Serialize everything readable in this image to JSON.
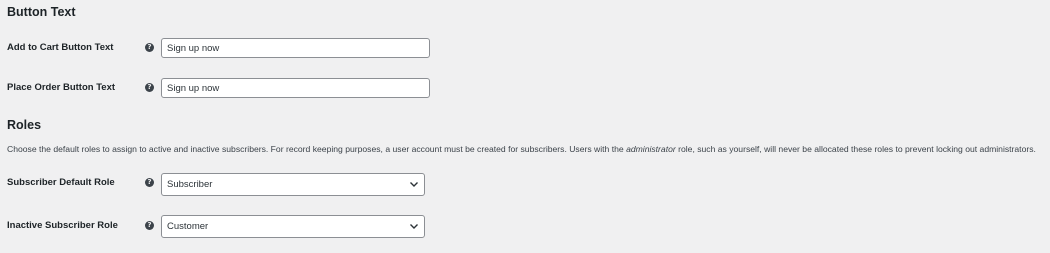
{
  "button_text_section": {
    "title": "Button Text",
    "add_to_cart": {
      "label": "Add to Cart Button Text",
      "help_icon": "question-circle-icon",
      "value": "Sign up now"
    },
    "place_order": {
      "label": "Place Order Button Text",
      "help_icon": "question-circle-icon",
      "value": "Sign up now"
    }
  },
  "roles_section": {
    "title": "Roles",
    "description_before": "Choose the default roles to assign to active and inactive subscribers. For record keeping purposes, a user account must be created for subscribers. Users with the ",
    "description_emphasis": "administrator",
    "description_after": " role, such as yourself, will never be allocated these roles to prevent locking out administrators.",
    "default_role": {
      "label": "Subscriber Default Role",
      "help_icon": "question-circle-icon",
      "selected": "Subscriber"
    },
    "inactive_role": {
      "label": "Inactive Subscriber Role",
      "help_icon": "question-circle-icon",
      "selected": "Customer"
    }
  },
  "colors": {
    "background": "#f0f0f1",
    "text": "#1d2327",
    "input_border": "#8c8f94"
  }
}
